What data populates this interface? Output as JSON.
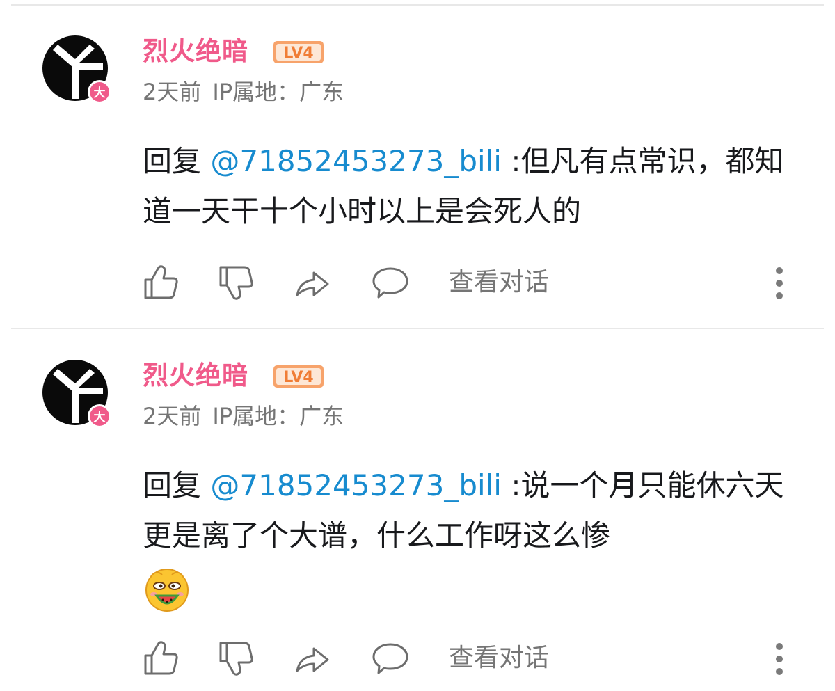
{
  "comments": [
    {
      "username": "烈火绝暗",
      "level": "LV4",
      "time": "2天前",
      "ip_location": "IP属地：广东",
      "reply_prefix": "回复",
      "mention": "@71852453273_bili",
      "text": " :但凡有点常识，都知道一天干十个小时以上是会死人的",
      "has_emoji": false,
      "view_conversation": "查看对话"
    },
    {
      "username": "烈火绝暗",
      "level": "LV4",
      "time": "2天前",
      "ip_location": "IP属地：广东",
      "reply_prefix": "回复",
      "mention": "@71852453273_bili",
      "text": " :说一个月只能休六天更是离了个大谱，什么工作呀这么惨",
      "has_emoji": true,
      "view_conversation": "查看对话"
    }
  ],
  "avatar_badge": "大",
  "colors": {
    "username": "#f05a8a",
    "mention": "#178bcf",
    "level_badge": "#f7a36b",
    "meta": "#757575",
    "icon": "#6d6d6d"
  },
  "icons": [
    "thumbs-up-icon",
    "thumbs-down-icon",
    "share-icon",
    "comment-bubble-icon",
    "more-vertical-icon"
  ]
}
